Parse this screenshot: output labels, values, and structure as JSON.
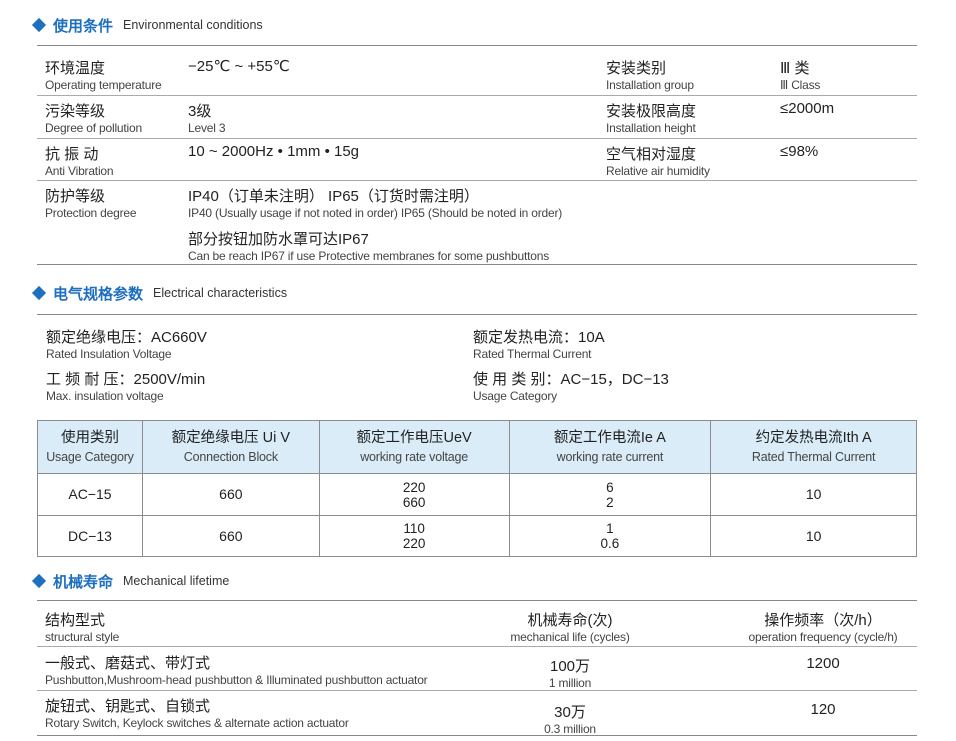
{
  "env": {
    "heading_cn": "使用条件",
    "heading_en": "Environmental conditions",
    "rows": [
      {
        "label_cn": "环境温度",
        "label_en": "Operating temperature",
        "value_cn": "−25℃ ~ +55℃",
        "value_en": ""
      },
      {
        "label_cn": "污染等级",
        "label_en": "Degree of pollution",
        "value_cn": "3级",
        "value_en": "Level 3"
      },
      {
        "label_cn": "抗 振 动",
        "label_en": "Anti Vibration",
        "value_cn": "10 ~ 2000Hz • 1mm • 15g",
        "value_en": ""
      },
      {
        "label_cn": "防护等级",
        "label_en": "Protection degree",
        "value_cn": "IP40（订单未注明） IP65（订货时需注明）",
        "value_en": "IP40 (Usually usage if not noted in order)   IP65 (Should be noted in order)"
      }
    ],
    "right_rows": [
      {
        "label_cn": "安装类别",
        "label_en": "Installation group",
        "value_cn": "Ⅲ 类",
        "value_en": "Ⅲ Class"
      },
      {
        "label_cn": "安装极限高度",
        "label_en": "Installation height",
        "value_cn": "≤2000m",
        "value_en": ""
      },
      {
        "label_cn": "空气相对湿度",
        "label_en": "Relative air humidity",
        "value_cn": "≤98%",
        "value_en": ""
      }
    ],
    "note_cn": "部分按钮加防水罩可达IP67",
    "note_en": "Can be reach IP67 if use Protective membranes for some pushbuttons"
  },
  "elec": {
    "heading_cn": "电气规格参数",
    "heading_en": "Electrical characteristics",
    "items": [
      {
        "cn": "额定绝缘电压：AC660V",
        "en": "Rated Insulation Voltage"
      },
      {
        "cn": "额定发热电流：10A",
        "en": "Rated Thermal Current"
      },
      {
        "cn": "工 频 耐 压：2500V/min",
        "en": "Max. insulation voltage"
      },
      {
        "cn": "使 用 类 别：AC−15，DC−13",
        "en": "Usage Category"
      }
    ],
    "table": {
      "headers": [
        {
          "cn": "使用类别",
          "en": "Usage Category"
        },
        {
          "cn": "额定绝缘电压 Ui V",
          "en": "Connection Block"
        },
        {
          "cn": "额定工作电压UeV",
          "en": "working rate voltage"
        },
        {
          "cn": "额定工作电流Ie A",
          "en": "working rate current"
        },
        {
          "cn": "约定发热电流Ith A",
          "en": "Rated Thermal Current"
        }
      ],
      "rows": [
        {
          "cat": "AC−15",
          "ui": "660",
          "ue1": "220",
          "ue2": "660",
          "ie1": "6",
          "ie2": "2",
          "ith": "10"
        },
        {
          "cat": "DC−13",
          "ui": "660",
          "ue1": "110",
          "ue2": "220",
          "ie1": "1",
          "ie2": "0.6",
          "ith": "10"
        }
      ]
    }
  },
  "mech": {
    "heading_cn": "机械寿命",
    "heading_en": "Mechanical lifetime",
    "cols": [
      {
        "cn": "结构型式",
        "en": "structural style"
      },
      {
        "cn": "机械寿命(次)",
        "en": "mechanical life (cycles)"
      },
      {
        "cn": "操作频率（次/h）",
        "en": "operation frequency (cycle/h)"
      }
    ],
    "rows": [
      {
        "cn": "一般式、磨菇式、带灯式",
        "en": "Pushbutton,Mushroom-head pushbutton & Illuminated pushbutton actuator",
        "life_cn": "100万",
        "life_en": "1 million",
        "freq": "1200"
      },
      {
        "cn": "旋钮式、钥匙式、自锁式",
        "en": "Rotary Switch, Keylock switches & alternate action actuator",
        "life_cn": "30万",
        "life_en": "0.3 million",
        "freq": "120"
      }
    ]
  }
}
